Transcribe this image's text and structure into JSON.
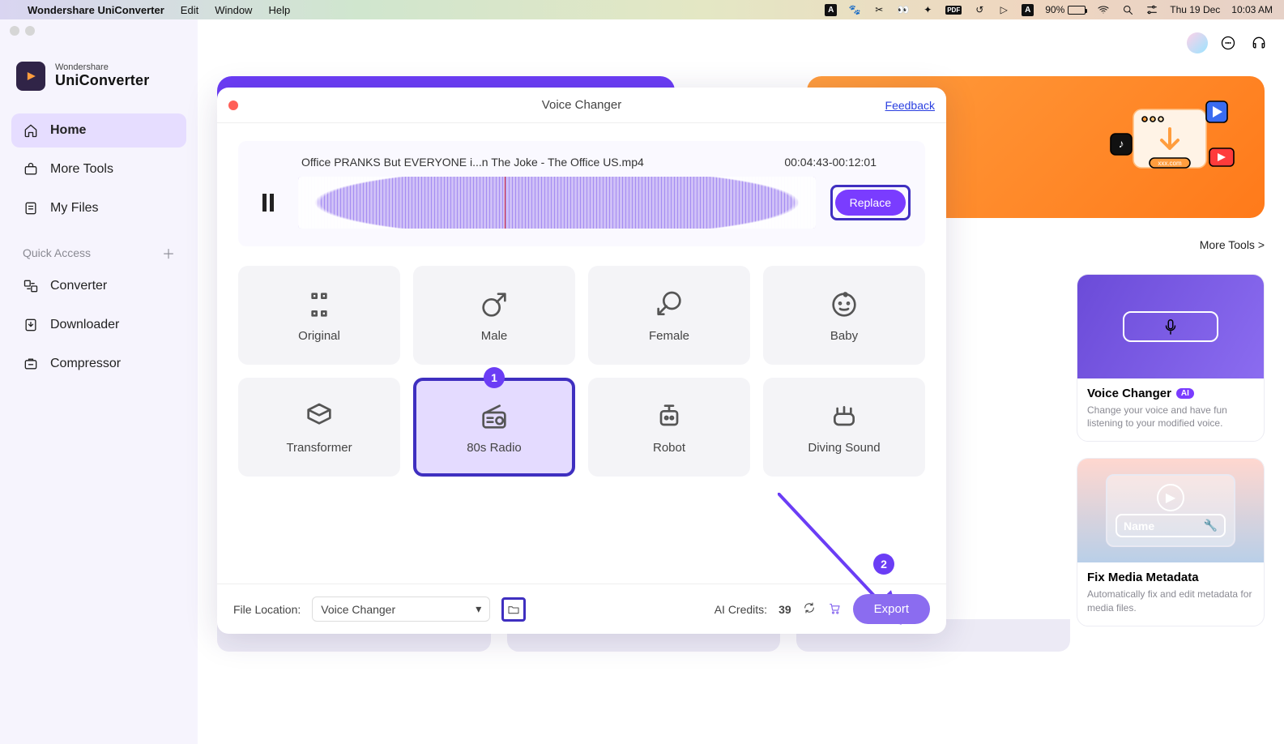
{
  "mac": {
    "app": "Wondershare UniConverter",
    "menus": [
      "Edit",
      "Window",
      "Help"
    ],
    "battery_pct": "90%",
    "date": "Thu 19 Dec",
    "time": "10:03 AM"
  },
  "brand": {
    "top": "Wondershare",
    "name": "UniConverter"
  },
  "nav": {
    "home": "Home",
    "moretools": "More Tools",
    "myfiles": "My Files",
    "quick_access": "Quick Access",
    "converter": "Converter",
    "downloader": "Downloader",
    "compressor": "Compressor"
  },
  "toplink": "More Tools >",
  "cards": {
    "vc_title": "Voice Changer",
    "vc_badge": "AI",
    "vc_desc": "Change your voice and have fun listening to your modified voice.",
    "mm_title": "Fix Media Metadata",
    "mm_desc": "Automatically fix and edit metadata for media files.",
    "mm_name": "Name"
  },
  "modal": {
    "title": "Voice Changer",
    "feedback": "Feedback",
    "file": "Office PRANKS But EVERYONE i...n The Joke - The Office US.mp4",
    "time": "00:04:43-00:12:01",
    "replace": "Replace",
    "options": {
      "original": "Original",
      "male": "Male",
      "female": "Female",
      "baby": "Baby",
      "transformer": "Transformer",
      "radio": "80s Radio",
      "robot": "Robot",
      "diving": "Diving Sound"
    },
    "annot1": "1",
    "annot2": "2",
    "file_loc_label": "File Location:",
    "file_loc_value": "Voice Changer",
    "credits_label": "AI Credits:",
    "credits_value": "39",
    "export": "Export"
  }
}
